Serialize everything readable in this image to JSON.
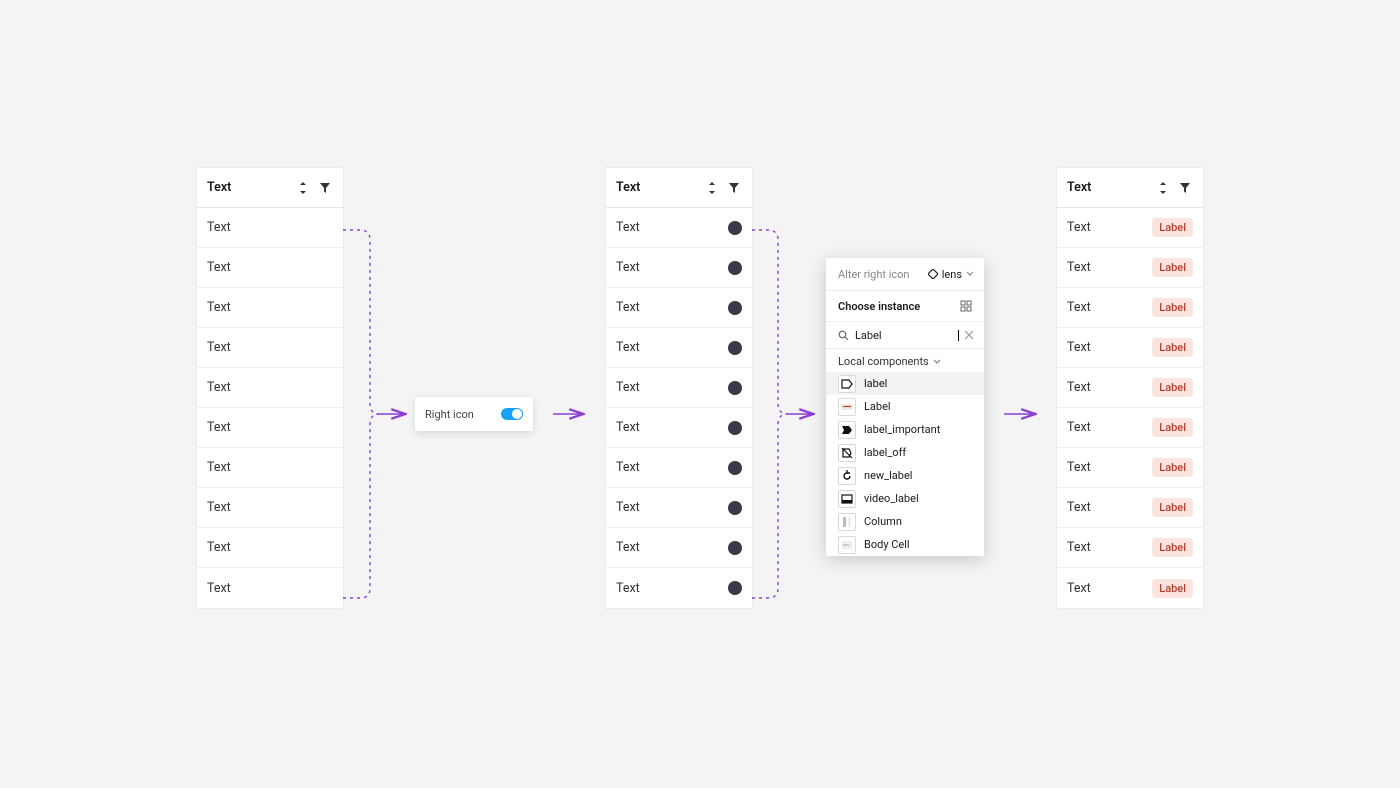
{
  "columns": {
    "header_label": "Text",
    "row_label": "Text",
    "row_count": 10
  },
  "right_icon_toggle": {
    "label": "Right icon",
    "value": true
  },
  "instance_picker": {
    "title": "Alter right icon",
    "current_value": "lens",
    "choose_title": "Choose instance",
    "search_value": "Label",
    "section_label": "Local components",
    "options": [
      {
        "name": "label",
        "icon": "label-outline-icon"
      },
      {
        "name": "Label",
        "icon": "label-chip-icon"
      },
      {
        "name": "label_important",
        "icon": "label-important-icon"
      },
      {
        "name": "label_off",
        "icon": "label-off-icon"
      },
      {
        "name": "new_label",
        "icon": "new-label-icon"
      },
      {
        "name": "video_label",
        "icon": "video-label-icon"
      },
      {
        "name": "Column",
        "icon": "column-icon"
      },
      {
        "name": "Body Cell",
        "icon": "body-cell-icon"
      }
    ]
  },
  "label_chip_text": "Label",
  "colors": {
    "flow_line": "#8c3fd1",
    "chip_bg": "#fbe4e0",
    "chip_text": "#b3402f",
    "toggle_on": "#18a0fb"
  }
}
